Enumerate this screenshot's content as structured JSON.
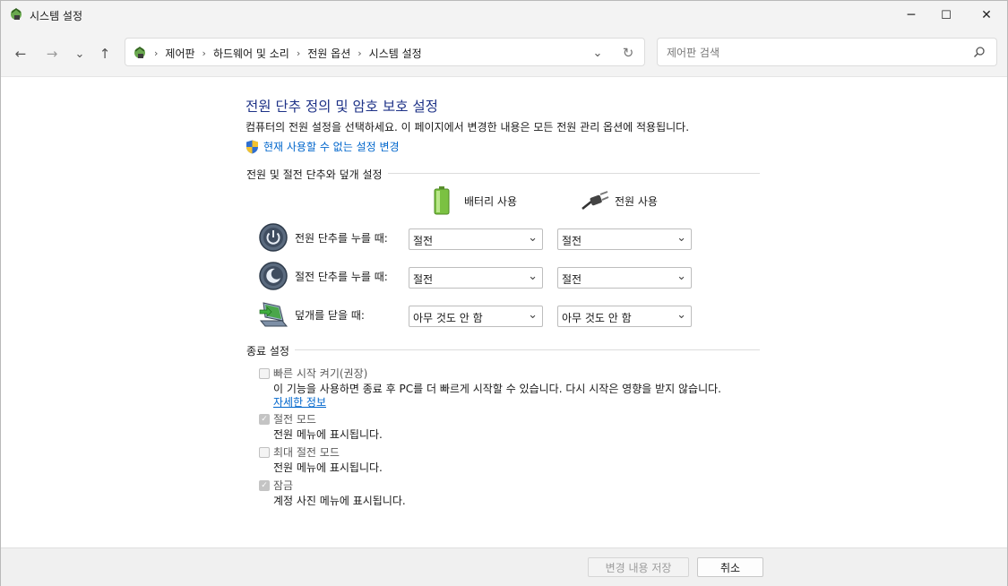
{
  "window": {
    "title": "시스템 설정",
    "minimize_glyph": "─",
    "maximize_glyph": "☐",
    "close_glyph": "✕"
  },
  "nav": {
    "back_glyph": "←",
    "forward_glyph": "→",
    "recent_glyph": "⌄",
    "up_glyph": "↑",
    "breadcrumbs": [
      "제어판",
      "하드웨어 및 소리",
      "전원 옵션",
      "시스템 설정"
    ],
    "separator": "›",
    "dropdown_glyph": "⌄",
    "refresh_glyph": "↻",
    "search_placeholder": "제어판 검색"
  },
  "page": {
    "title": "전원 단추 정의 및 암호 보호 설정",
    "description": "컴퓨터의 전원 설정을 선택하세요. 이 페이지에서 변경한 내용은 모든 전원 관리 옵션에 적용됩니다.",
    "change_unavailable_link": "현재 사용할 수 없는 설정 변경"
  },
  "buttons_section": {
    "group_label": "전원 및 절전 단추와 덮개 설정",
    "col_battery": "배터리 사용",
    "col_plugged": "전원 사용",
    "rows": [
      {
        "label": "전원 단추를 누를 때:",
        "battery": "절전",
        "plugged": "절전"
      },
      {
        "label": "절전 단추를 누를 때:",
        "battery": "절전",
        "plugged": "절전"
      },
      {
        "label": "덮개를 닫을 때:",
        "battery": "아무 것도 안 함",
        "plugged": "아무 것도 안 함"
      }
    ]
  },
  "shutdown_section": {
    "group_label": "종료 설정",
    "fast_startup": {
      "label": "빠른 시작 켜기(권장)",
      "checked": false,
      "description": "이 기능을 사용하면 종료 후 PC를 더 빠르게 시작할 수 있습니다. 다시 시작은 영향을 받지 않습니다.",
      "more_link": "자세한 정보"
    },
    "sleep": {
      "label": "절전 모드",
      "checked": true,
      "description": "전원 메뉴에 표시됩니다."
    },
    "hibernate": {
      "label": "최대 절전 모드",
      "checked": false,
      "description": "전원 메뉴에 표시됩니다."
    },
    "lock": {
      "label": "잠금",
      "checked": true,
      "description": "계정 사진 메뉴에 표시됩니다."
    }
  },
  "footer": {
    "save_label": "변경 내용 저장",
    "cancel_label": "취소"
  },
  "colors": {
    "title_blue": "#1e3287",
    "link_blue": "#0066cc",
    "chrome_bg": "#f3f3f3"
  }
}
